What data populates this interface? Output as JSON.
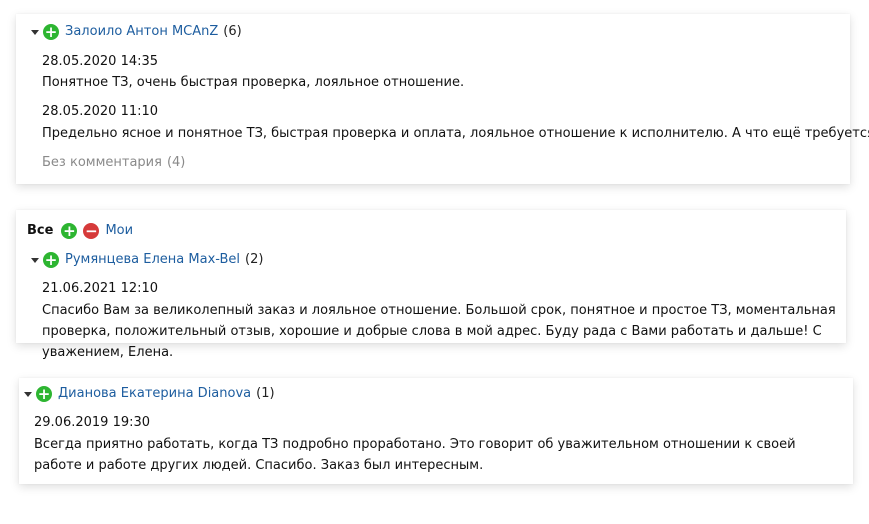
{
  "block1": {
    "author": "Залоило Антон MCAnZ",
    "count": "(6)",
    "reviews": [
      {
        "date": "28.05.2020 14:35",
        "text": "Понятное ТЗ, очень быстрая проверка, лояльное отношение."
      },
      {
        "date": "28.05.2020 11:10",
        "text": "Предельно ясное и понятное ТЗ, быстрая проверка и оплата, лояльное отношение к исполнителю. А что ещё требуется? :)"
      }
    ],
    "no_comment": "Без комментария",
    "no_comment_count": "(4)"
  },
  "block2": {
    "filter_all": "Все",
    "filter_mine": "Мои",
    "author": "Румянцева Елена Max-Bel",
    "count": "(2)",
    "review": {
      "date": "21.06.2021 12:10",
      "text": "Спасибо Вам за великолепный заказ и лояльное отношение. Большой срок, понятное и простое ТЗ, моментальная проверка, положительный отзыв, хорошие и добрые слова в мой адрес. Буду рада с Вами работать и дальше! С уважением, Елена."
    }
  },
  "block3": {
    "author": "Дианова Екатерина Dianova",
    "count": "(1)",
    "review": {
      "date": "29.06.2019 19:30",
      "text": "Всегда приятно работать, когда ТЗ подробно проработано. Это говорит об уважительном отношении к своей работе и работе других людей. Спасибо. Заказ был интересным."
    }
  },
  "colors": {
    "link": "#1d5d9f",
    "plus": "#2db531",
    "minus": "#d63a3a",
    "muted": "#8a8a8a"
  }
}
